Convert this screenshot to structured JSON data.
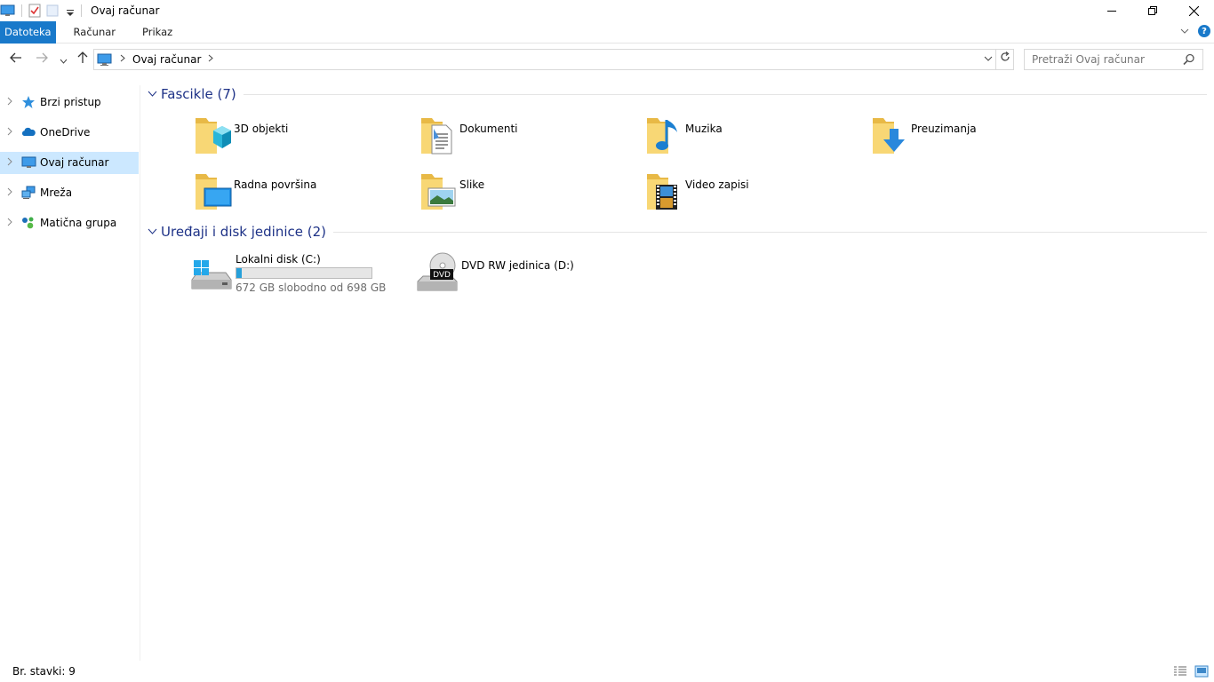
{
  "window": {
    "title": "Ovaj računar",
    "minimize": "—",
    "restore": "❐",
    "close": "✕"
  },
  "ribbon": {
    "tabs": [
      {
        "label": "Datoteka",
        "active": true
      },
      {
        "label": "Računar",
        "active": false
      },
      {
        "label": "Prikaz",
        "active": false
      }
    ],
    "help_label": "?"
  },
  "address": {
    "crumb": "Ovaj računar",
    "search_placeholder": "Pretraži Ovaj računar"
  },
  "sidebar": {
    "items": [
      {
        "label": "Brzi pristup",
        "icon": "star-icon"
      },
      {
        "label": "OneDrive",
        "icon": "cloud-icon"
      },
      {
        "label": "Ovaj računar",
        "icon": "computer-icon",
        "selected": true
      },
      {
        "label": "Mreža",
        "icon": "network-icon"
      },
      {
        "label": "Matična grupa",
        "icon": "homegroup-icon"
      }
    ]
  },
  "folders": {
    "title": "Fascikle (7)",
    "items": [
      {
        "label": "3D objekti",
        "icon": "3d-objects-folder-icon"
      },
      {
        "label": "Dokumenti",
        "icon": "documents-folder-icon"
      },
      {
        "label": "Muzika",
        "icon": "music-folder-icon"
      },
      {
        "label": "Preuzimanja",
        "icon": "downloads-folder-icon"
      },
      {
        "label": "Radna površina",
        "icon": "desktop-folder-icon"
      },
      {
        "label": "Slike",
        "icon": "pictures-folder-icon"
      },
      {
        "label": "Video zapisi",
        "icon": "videos-folder-icon"
      }
    ]
  },
  "devices": {
    "title": "Uređaji i disk jedinice (2)",
    "items": [
      {
        "label": "Lokalni disk (C:)",
        "free_text": "672 GB slobodno od 698 GB",
        "used_fraction": 0.037,
        "icon": "local-disk-icon"
      },
      {
        "label": "DVD RW jedinica (D:)",
        "icon": "dvd-drive-icon",
        "badge": "DVD"
      }
    ]
  },
  "status": {
    "count": "Br. stavki: 9"
  },
  "colors": {
    "accent": "#1979ca",
    "selection": "#cce8ff",
    "group_title": "#1e3287",
    "folder": "#f8d775",
    "progress": "#26a0da"
  }
}
